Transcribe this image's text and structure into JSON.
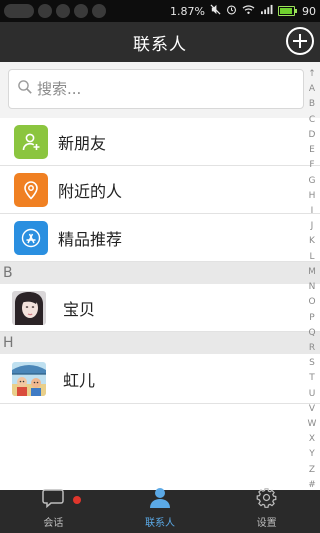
{
  "status_bar": {
    "battery_text": "1.87%",
    "battery_level": "90",
    "icons": [
      "mute-icon",
      "alarm-icon",
      "wifi-icon",
      "signal-icon",
      "battery-icon"
    ]
  },
  "header": {
    "title": "联系人",
    "add_icon": "plus-circle-icon"
  },
  "search": {
    "placeholder": "搜索...",
    "icon": "search-icon"
  },
  "features": [
    {
      "label": "新朋友",
      "icon": "new-friend-icon",
      "color": "#8bc53f"
    },
    {
      "label": "附近的人",
      "icon": "location-pin-icon",
      "color": "#f08022"
    },
    {
      "label": "精品推荐",
      "icon": "app-store-icon",
      "color": "#2a8fe0"
    }
  ],
  "sections": [
    {
      "letter": "B",
      "contacts": [
        {
          "name": "宝贝",
          "avatar": "avatar-girl"
        }
      ]
    },
    {
      "letter": "H",
      "contacts": [
        {
          "name": "虹儿",
          "avatar": "avatar-cartoon"
        }
      ]
    }
  ],
  "index": [
    "↑",
    "A",
    "B",
    "C",
    "D",
    "E",
    "F",
    "G",
    "H",
    "I",
    "J",
    "K",
    "L",
    "M",
    "N",
    "O",
    "P",
    "Q",
    "R",
    "S",
    "T",
    "U",
    "V",
    "W",
    "X",
    "Y",
    "Z",
    "#"
  ],
  "tabs": [
    {
      "label": "会话",
      "icon": "chat-bubble-icon",
      "active": false,
      "badge": true
    },
    {
      "label": "联系人",
      "icon": "contacts-person-icon",
      "active": true,
      "badge": false
    },
    {
      "label": "设置",
      "icon": "gear-icon",
      "active": false,
      "badge": false
    }
  ]
}
